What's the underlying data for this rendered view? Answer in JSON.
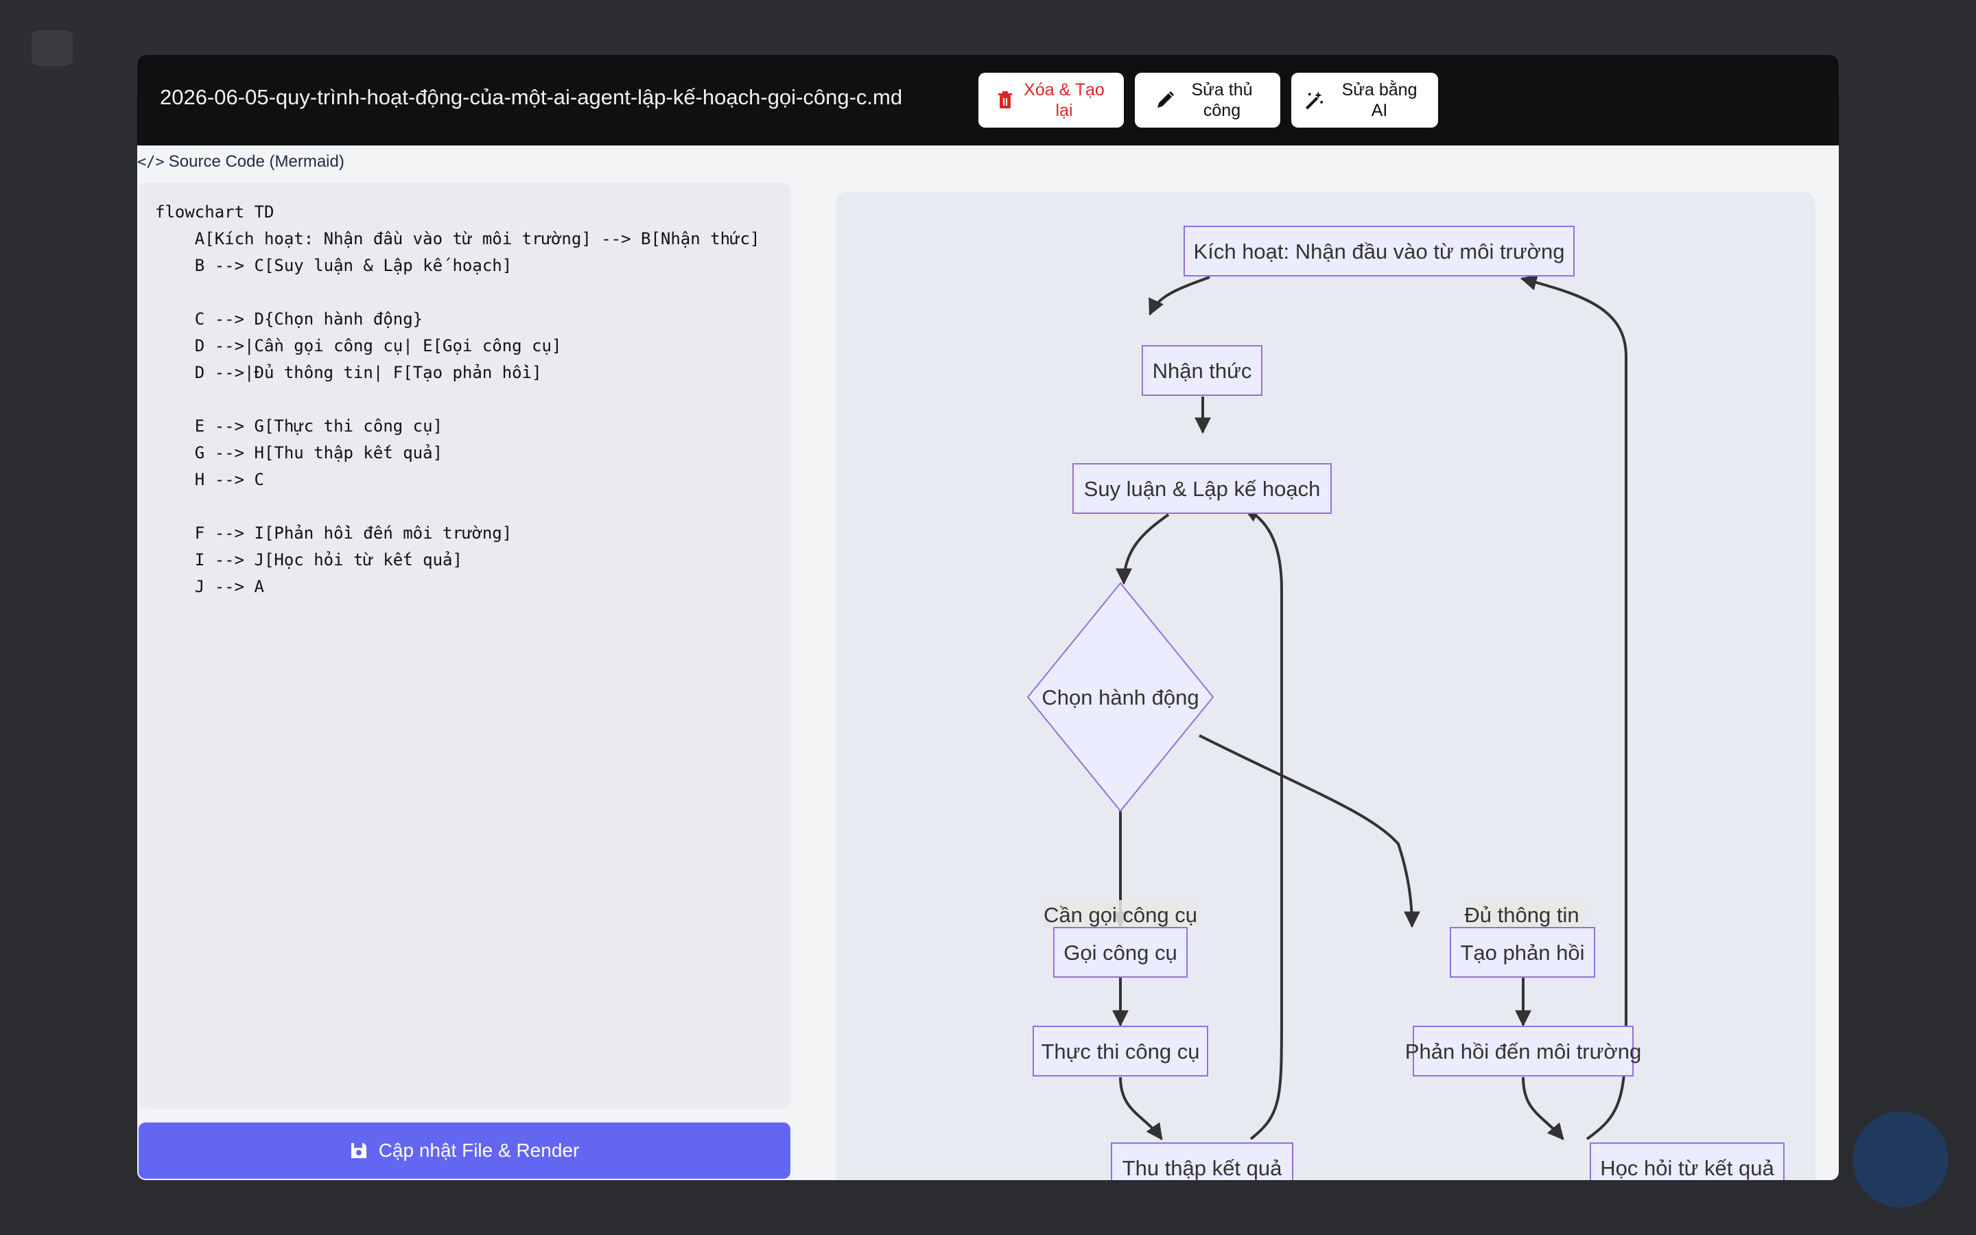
{
  "header": {
    "file_title": "2026-06-05-quy-trình-hoạt-động-của-một-ai-agent-lập-kế-hoạch-gọi-công-c.md",
    "delete_label": "Xóa & Tạo lại",
    "manual_label": "Sửa thủ công",
    "ai_label": "Sửa bằng AI",
    "close_label": "×"
  },
  "source": {
    "label": "Source Code (Mermaid)",
    "code": "flowchart TD\n    A[Kích hoạt: Nhận đầu vào từ môi trường] --> B[Nhận thức]\n    B --> C[Suy luận & Lập kế hoạch]\n\n    C --> D{Chọn hành động}\n    D -->|Cần gọi công cụ| E[Gọi công cụ]\n    D -->|Đủ thông tin| F[Tạo phản hồi]\n\n    E --> G[Thực thi công cụ]\n    G --> H[Thu thập kết quả]\n    H --> C\n\n    F --> I[Phản hồi đến môi trường]\n    I --> J[Học hỏi từ kết quả]\n    J --> A"
  },
  "update_button": {
    "label": "Cập nhật File & Render"
  },
  "diagram": {
    "nodes": {
      "A": "Kích hoạt: Nhận đầu vào từ môi trường",
      "B": "Nhận thức",
      "C": "Suy luận & Lập kế hoạch",
      "D": "Chọn hành động",
      "E": "Gọi công cụ",
      "F": "Tạo phản hồi",
      "G": "Thực thi công cụ",
      "H": "Thu thập kết quả",
      "I": "Phản hồi đến môi trường",
      "J": "Học hỏi từ kết quả"
    },
    "edge_labels": {
      "DE": "Cần gọi công cụ",
      "DF": "Đủ thông tin"
    }
  },
  "colors": {
    "accent": "#6366f1",
    "delete_text": "#dc2626",
    "node_fill": "#ececff",
    "node_stroke": "#9370db",
    "header_bg": "#0f1011"
  },
  "icons": [
    "trash-icon",
    "pencil-icon",
    "magic-wand-icon",
    "close-icon",
    "code-icon",
    "save-icon"
  ]
}
